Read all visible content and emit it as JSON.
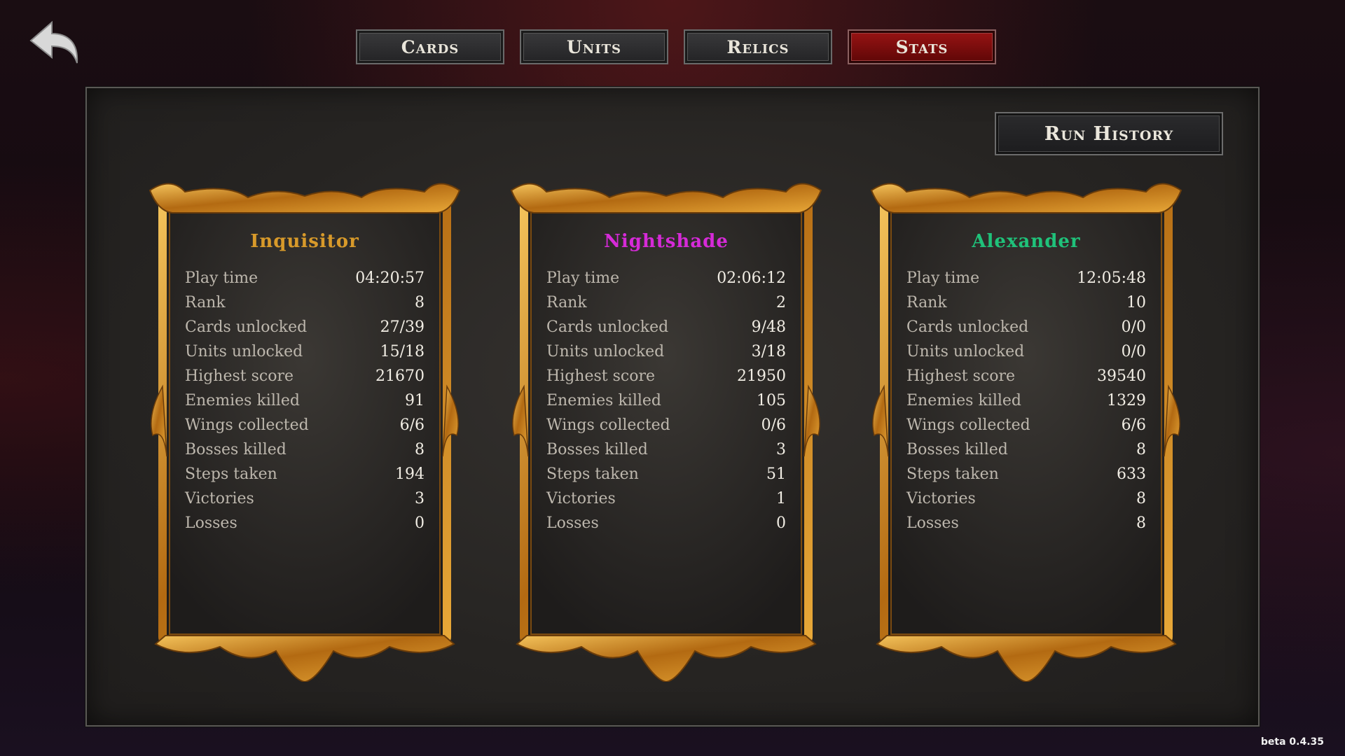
{
  "nav": {
    "tabs": [
      {
        "label": "Cards",
        "active": false
      },
      {
        "label": "Units",
        "active": false
      },
      {
        "label": "Relics",
        "active": false
      },
      {
        "label": "Stats",
        "active": true
      }
    ]
  },
  "run_history_label": "Run History",
  "characters": [
    {
      "name": "Inquisitor",
      "name_color": "#d89a2a",
      "stats": [
        {
          "label": "Play time",
          "value": "04:20:57"
        },
        {
          "label": "Rank",
          "value": "8"
        },
        {
          "label": "Cards unlocked",
          "value": "27/39"
        },
        {
          "label": "Units unlocked",
          "value": "15/18"
        },
        {
          "label": "Highest score",
          "value": "21670"
        },
        {
          "label": "Enemies killed",
          "value": "91"
        },
        {
          "label": "Wings collected",
          "value": "6/6"
        },
        {
          "label": "Bosses killed",
          "value": "8"
        },
        {
          "label": "Steps taken",
          "value": "194"
        },
        {
          "label": "Victories",
          "value": "3"
        },
        {
          "label": "Losses",
          "value": "0"
        }
      ]
    },
    {
      "name": "Nightshade",
      "name_color": "#d62ad8",
      "stats": [
        {
          "label": "Play time",
          "value": "02:06:12"
        },
        {
          "label": "Rank",
          "value": "2"
        },
        {
          "label": "Cards unlocked",
          "value": "9/48"
        },
        {
          "label": "Units unlocked",
          "value": "3/18"
        },
        {
          "label": "Highest score",
          "value": "21950"
        },
        {
          "label": "Enemies killed",
          "value": "105"
        },
        {
          "label": "Wings collected",
          "value": "0/6"
        },
        {
          "label": "Bosses killed",
          "value": "3"
        },
        {
          "label": "Steps taken",
          "value": "51"
        },
        {
          "label": "Victories",
          "value": "1"
        },
        {
          "label": "Losses",
          "value": "0"
        }
      ]
    },
    {
      "name": "Alexander",
      "name_color": "#1fc27a",
      "stats": [
        {
          "label": "Play time",
          "value": "12:05:48"
        },
        {
          "label": "Rank",
          "value": "10"
        },
        {
          "label": "Cards unlocked",
          "value": "0/0"
        },
        {
          "label": "Units unlocked",
          "value": "0/0"
        },
        {
          "label": "Highest score",
          "value": "39540"
        },
        {
          "label": "Enemies killed",
          "value": "1329"
        },
        {
          "label": "Wings collected",
          "value": "6/6"
        },
        {
          "label": "Bosses killed",
          "value": "8"
        },
        {
          "label": "Steps taken",
          "value": "633"
        },
        {
          "label": "Victories",
          "value": "8"
        },
        {
          "label": "Losses",
          "value": "8"
        }
      ]
    }
  ],
  "version": "beta 0.4.35",
  "icons": {
    "back": "back-arrow-icon"
  }
}
